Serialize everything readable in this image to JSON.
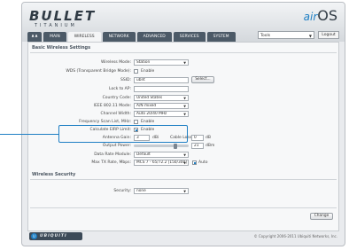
{
  "header": {
    "brand": "BULLET",
    "brand_sub": "TITANIUM",
    "os_prefix": "air",
    "os_name": "OS",
    "tools_value": "Tools",
    "logout_label": "Logout"
  },
  "tabs": [
    {
      "label": "MAIN"
    },
    {
      "label": "WIRELESS"
    },
    {
      "label": "NETWORK"
    },
    {
      "label": "ADVANCED"
    },
    {
      "label": "SERVICES"
    },
    {
      "label": "SYSTEM"
    }
  ],
  "wireless": {
    "section_title": "Basic Wireless Settings",
    "wireless_mode_label": "Wireless Mode:",
    "wireless_mode_value": "Station",
    "wds_label": "WDS (Transparent Bridge Mode):",
    "wds_text": "Enable",
    "ssid_label": "SSID:",
    "ssid_value": "ubnt",
    "select_button": "Select...",
    "lock_label": "Lock to AP:",
    "country_label": "Country Code:",
    "country_value": "United States",
    "ieee_label": "IEEE 802.11 Mode:",
    "ieee_value": "A/N mixed",
    "width_label": "Channel Width:",
    "width_value": "Auto 20/40 MHz",
    "freq_label": "Frequency Scan List, MHz:",
    "freq_text": "Enable",
    "erp_label": "Calculate EIRP Limit:",
    "erp_text": "Enable",
    "antenna_gain_label": "Antenna Gain:",
    "antenna_gain_value": "3",
    "antenna_gain_unit": "dBi",
    "cable_loss_label": "Cable Loss:",
    "cable_loss_value": "0",
    "cable_loss_unit": "dB",
    "output_power_label": "Output Power:",
    "output_power_value": "21",
    "output_power_unit": "dBm",
    "output_power_fraction": 0.78,
    "data_rate_label": "Data Rate Module:",
    "data_rate_value": "Default",
    "max_rate_label": "Max TX Rate, Mbps:",
    "max_rate_value": "MCS 7 - 65/72.2 [150/300]",
    "auto_text": "Auto"
  },
  "security": {
    "section_title": "Wireless Security",
    "security_label": "Security:",
    "security_value": "none"
  },
  "footer": {
    "change_button": "Change",
    "logo_word": "UBIQUITI NETWORKS",
    "copyright": "© Copyright 2006-2011 Ubiquiti Networks, Inc."
  }
}
